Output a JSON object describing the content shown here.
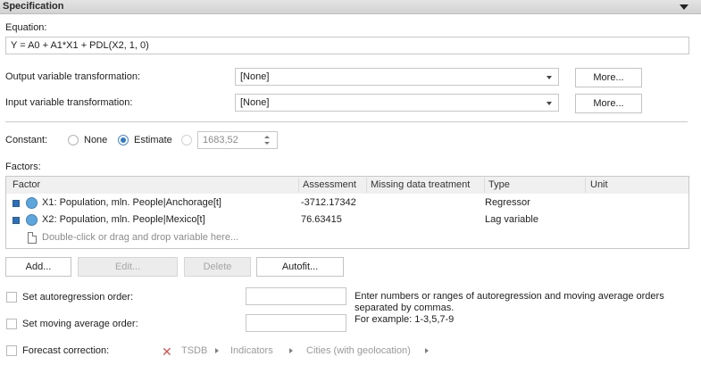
{
  "header": {
    "title": "Specification"
  },
  "equation": {
    "label": "Equation:",
    "value": "Y = A0 + A1*X1 + PDL(X2, 1, 0)"
  },
  "output_transform": {
    "label": "Output variable transformation:",
    "value": "[None]",
    "more_label": "More..."
  },
  "input_transform": {
    "label": "Input variable transformation:",
    "value": "[None]",
    "more_label": "More..."
  },
  "constant": {
    "label": "Constant:",
    "options": [
      "None",
      "Estimate"
    ],
    "selected": "Estimate",
    "value": "1683,52"
  },
  "factors": {
    "label": "Factors:",
    "columns": [
      "Factor",
      "Assessment",
      "Missing data treatment",
      "Type",
      "Unit"
    ],
    "rows": [
      {
        "factor": "X1: Population, mln. People|Anchorage[t]",
        "assessment": "-3712.17342",
        "missing": "",
        "type": "Regressor",
        "unit": ""
      },
      {
        "factor": "X2: Population, mln. People|Mexico[t]",
        "assessment": "76.63415",
        "missing": "",
        "type": "Lag variable",
        "unit": ""
      }
    ],
    "placeholder": "Double-click or drag and drop variable here..."
  },
  "buttons": {
    "add": "Add...",
    "edit": "Edit...",
    "delete": "Delete",
    "autofit": "Autofit..."
  },
  "autoregression": {
    "label": "Set autoregression order:",
    "value": ""
  },
  "moving_average": {
    "label": "Set moving average order:",
    "value": ""
  },
  "hint": {
    "line1": "Enter numbers or ranges of autoregression and moving average orders",
    "line2": "separated by commas.",
    "line3": "For example: 1-3,5,7-9"
  },
  "forecast_correction": {
    "label": "Forecast correction:",
    "breadcrumb": [
      "TSDB",
      "Indicators",
      "Cities (with geolocation)"
    ]
  },
  "colors": {
    "accent": "#2f78c4",
    "header_bg": "#d9d9d9",
    "factor_icon": "#5da6dc",
    "clear_icon": "#d9534f"
  }
}
